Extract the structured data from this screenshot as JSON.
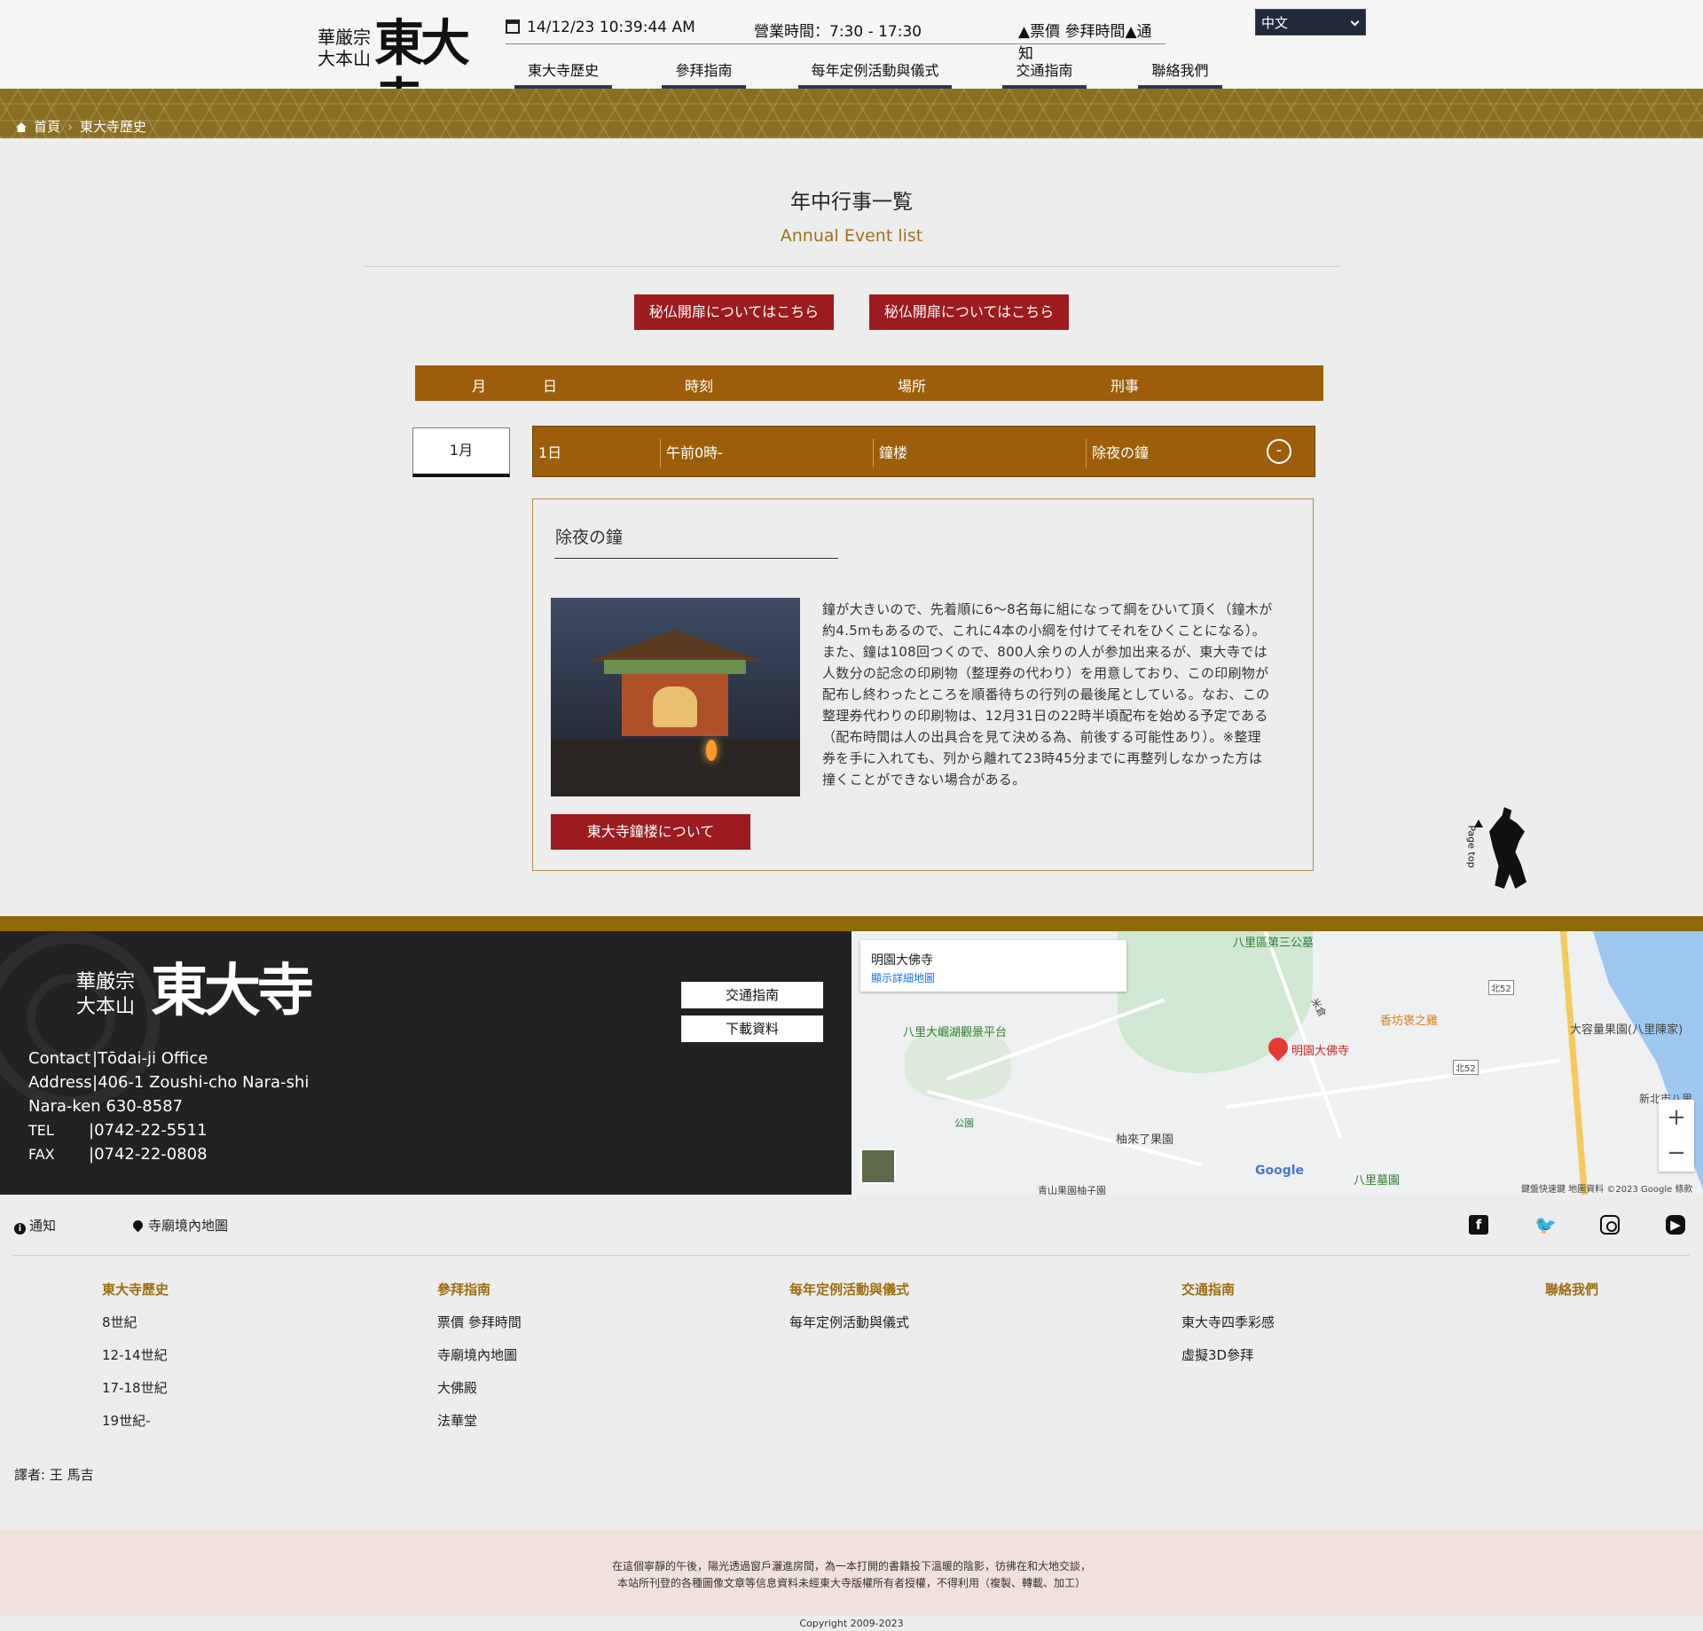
{
  "header": {
    "logo_small_line1": "華厳宗",
    "logo_small_line2": "大本山",
    "logo_big": "東大寺",
    "datetime": "14/12/23  10:39:44 AM",
    "hours": "營業時間：7:30 - 17:30",
    "quick_links": "▲票價 參拜時間▲通知",
    "language": "中文",
    "nav": [
      "東大寺歷史",
      "參拜指南",
      "每年定例活動與儀式",
      "交通指南",
      "聯絡我們"
    ]
  },
  "breadcrumb": {
    "home": "首頁",
    "current": "東大寺歷史"
  },
  "main": {
    "title_jp": "年中行事一覧",
    "title_en": "Annual Event list",
    "buttons": [
      "秘仏開扉についてはこちら",
      "秘仏開扉についてはこちら"
    ],
    "table_headers": [
      "月",
      "日",
      "時刻",
      "場所",
      "刑事"
    ],
    "month": "1月",
    "row": {
      "day": "1日",
      "time": "午前0時-",
      "place": "鐘楼",
      "event": "除夜の鐘",
      "toggle": "-"
    },
    "detail": {
      "title": "除夜の鐘",
      "text": "鐘が大きいので、先着順に6～8名毎に組になって綱をひいて頂く（鐘木が約4.5mもあるので、これに4本の小綱を付けてそれをひくことになる）。また、鐘は108回つくので、800人余りの人が参加出来るが、東大寺では人数分の記念の印刷物（整理券の代わり）を用意しており、この印刷物が配布し終わったところを順番待ちの行列の最後尾としている。なお、この整理券代わりの印刷物は、12月31日の22時半頃配布を始める予定である（配布時間は人の出具合を見て決める為、前後する可能性あり）。※整理券を手に入れても、列から離れて23時45分までに再整列しなかった方は撞くことができない場合がある。",
      "button": "東大寺鐘楼について"
    },
    "page_top": "Page top"
  },
  "footer": {
    "logo_small_line1": "華厳宗",
    "logo_small_line2": "大本山",
    "logo_big": "東大寺",
    "contact": [
      {
        "key": "Contact",
        "value": "|Tōdai-ji Office"
      },
      {
        "key": "Address",
        "value": "|406-1 Zoushi-cho Nara-shi"
      },
      {
        "key": "",
        "value": "Nara-ken 630-8587"
      },
      {
        "key": "TEL",
        "value": "|0742-22-5511"
      },
      {
        "key": "FAX",
        "value": "|0742-22-0808"
      }
    ],
    "buttons": [
      "交通指南",
      "下載資料"
    ],
    "map": {
      "place": "明園大佛寺",
      "link": "顯示詳細地圖",
      "labels": [
        "八里區第三公墓",
        "八里大崛湖觀景平台",
        "香坊褒之雞",
        "大容量果園(八里陳家)",
        "明園大佛寺",
        "公園",
        "柚來了果園",
        "八里墓園",
        "北52",
        "北52",
        "新北市八里",
        "米倉",
        "青山果園柚子園"
      ],
      "google": "Google",
      "attribution": "鍵盤快速鍵  地圖資料 ©2023 Google  條款",
      "zoom_in": "+",
      "zoom_out": "−"
    },
    "notice": "通知",
    "temple_map": "寺廟境內地圖",
    "columns": [
      {
        "heading": "東大寺歷史",
        "items": [
          "8世紀",
          "12-14世紀",
          "17-18世紀",
          "19世紀-"
        ]
      },
      {
        "heading": "參拜指南",
        "items": [
          "票價 參拜時間",
          "寺廟境內地圖",
          "大佛殿",
          "法華堂"
        ]
      },
      {
        "heading": "每年定例活動與儀式",
        "items": [
          "每年定例活動與儀式"
        ]
      },
      {
        "heading": "交通指南",
        "items": [
          "東大寺四季彩感",
          "虛擬3D參拜"
        ]
      },
      {
        "heading": "聯絡我們",
        "items": []
      }
    ],
    "translator": "譯者: 王 馬吉",
    "disclaimer1": "在這個寧靜的午後，陽光透過窗戶灑進房間，為一本打開的書籍投下溫暖的陰影，彷彿在和大地交談，",
    "disclaimer2": "本站所刊登的各種圖像文章等信息資料未經東大寺版權所有者授權，不得利用（複製、轉載、加工）",
    "copyright": "Copyright 2009-2023"
  }
}
